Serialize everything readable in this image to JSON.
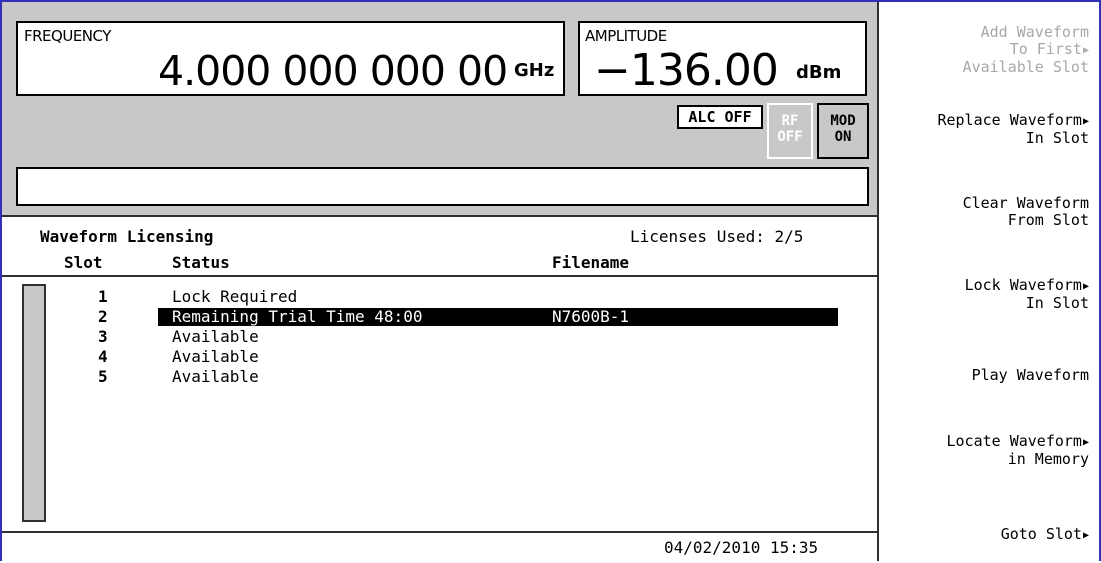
{
  "frequency": {
    "label": "FREQUENCY",
    "value": "4.000 000 000 00",
    "unit": "GHz"
  },
  "amplitude": {
    "label": "AMPLITUDE",
    "value": "−136.00",
    "unit": "dBm"
  },
  "annunciators": {
    "alc": "ALC OFF",
    "rf_line1": "RF",
    "rf_line2": "OFF",
    "mod_line1": "MOD",
    "mod_line2": "ON"
  },
  "message": "",
  "licensing": {
    "title": "Waveform Licensing",
    "licenses_used": "Licenses Used: 2/5",
    "columns": {
      "slot": "Slot",
      "status": "Status",
      "filename": "Filename"
    },
    "rows": [
      {
        "slot": "1",
        "status": "Lock Required",
        "filename": ""
      },
      {
        "slot": "2",
        "status": "Remaining Trial Time 48:00",
        "filename": "N7600B-1",
        "selected": true
      },
      {
        "slot": "3",
        "status": "Available",
        "filename": ""
      },
      {
        "slot": "4",
        "status": "Available",
        "filename": ""
      },
      {
        "slot": "5",
        "status": "Available",
        "filename": ""
      }
    ]
  },
  "datetime": "04/02/2010 15:35",
  "softkeys": [
    {
      "line1": "Add Waveform",
      "line2": "To First",
      "line3": "Available Slot",
      "enabled": false,
      "submenu": true,
      "icon": "triangle-right-icon"
    },
    {
      "line1": "Replace Waveform",
      "line2": "In Slot",
      "enabled": true,
      "submenu": true,
      "icon": "triangle-right-icon"
    },
    {
      "line1": "Clear Waveform",
      "line2": "From Slot",
      "enabled": true,
      "submenu": false
    },
    {
      "line1": "Lock Waveform",
      "line2": "In Slot",
      "enabled": true,
      "submenu": true,
      "icon": "triangle-right-icon"
    },
    {
      "line1": "Play Waveform",
      "enabled": true,
      "submenu": false
    },
    {
      "line1": "Locate Waveform",
      "line2": "in Memory",
      "enabled": true,
      "submenu": true,
      "icon": "triangle-right-icon"
    },
    {
      "line1": "Goto Slot",
      "enabled": true,
      "submenu": true,
      "icon": "triangle-right-icon"
    }
  ],
  "colors": {
    "frame_border": "#3030b8",
    "panel_gray": "#c8c8c8",
    "disabled_text": "#a8a8a8",
    "highlight": "#000000"
  }
}
